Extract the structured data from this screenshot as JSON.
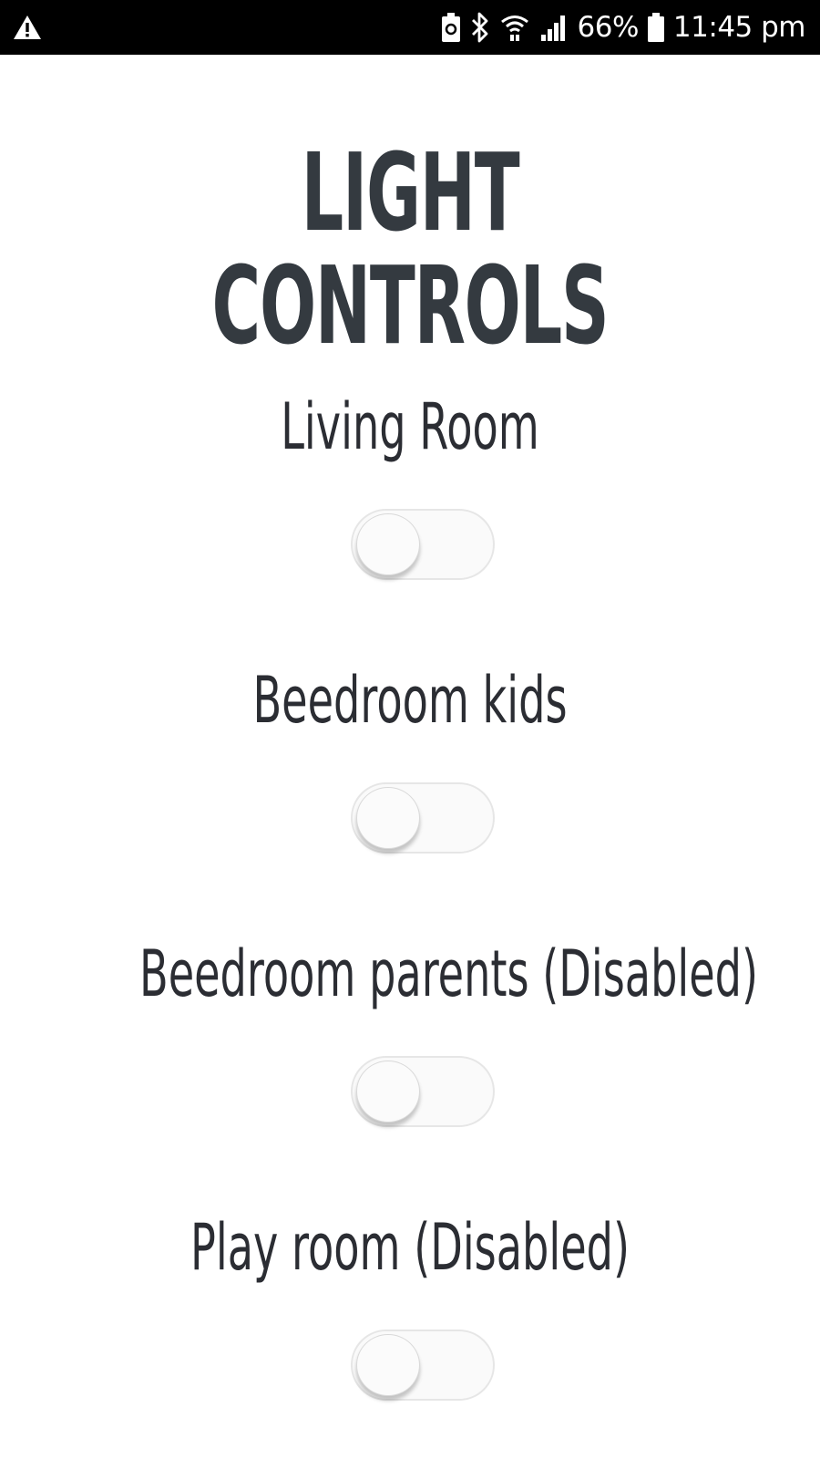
{
  "status_bar": {
    "battery_percent": "66%",
    "time": "11:45 pm",
    "icons": [
      "warning-icon",
      "battery-saver-icon",
      "bluetooth-icon",
      "wifi-icon",
      "signal-icon",
      "battery-icon"
    ]
  },
  "page": {
    "title": "LIGHT CONTROLS"
  },
  "controls": [
    {
      "label": "Living Room",
      "on": false
    },
    {
      "label": "Beedroom kids",
      "on": false
    },
    {
      "label": "Beedroom parents (Disabled)",
      "on": false
    },
    {
      "label": "Play room (Disabled)",
      "on": false
    }
  ],
  "colors": {
    "status_bar_bg": "#000000",
    "title": "#343a40",
    "label": "#2b2d33",
    "toggle_track": "#fafafa",
    "toggle_border": "#e6e6e6"
  }
}
